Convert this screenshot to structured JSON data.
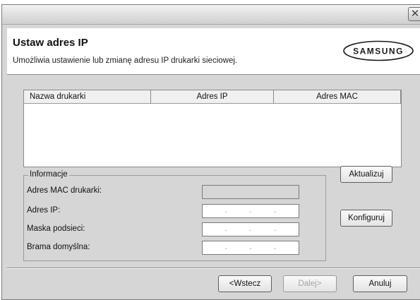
{
  "window": {
    "close_glyph": "✕"
  },
  "header": {
    "title": "Ustaw adres IP",
    "subtitle": "Umożliwia ustawienie lub zmianę adresu IP drukarki sieciowej.",
    "brand": "SAMSUNG"
  },
  "list": {
    "columns": [
      "Nazwa drukarki",
      "Adres IP",
      "Adres MAC"
    ],
    "rows": []
  },
  "info": {
    "group_label": "Informacje",
    "fields": [
      {
        "label": "Adres MAC drukarki:",
        "value": ""
      },
      {
        "label": "Adres IP:",
        "value": ""
      },
      {
        "label": "Maska podsieci:",
        "value": ""
      },
      {
        "label": "Brama domyślna:",
        "value": ""
      }
    ],
    "ip_separator": "."
  },
  "buttons": {
    "refresh": "Aktualizuj",
    "configure": "Konfiguruj",
    "back": "<Wstecz",
    "next": "Dalej>",
    "cancel": "Anuluj"
  },
  "colors": {
    "dialog_bg": "#d6d6d6",
    "header_bg": "#ffffff",
    "brand_logo_fill": "#ffffff",
    "brand_logo_text": "#1a1a1a"
  }
}
